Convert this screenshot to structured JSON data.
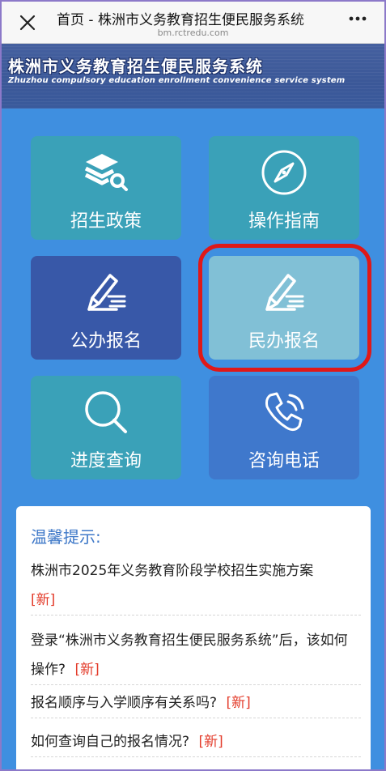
{
  "browser": {
    "title": "首页 - 株洲市义务教育招生便民服务系统",
    "domain": "bm.rctredu.com",
    "close_icon": "close-icon",
    "more_icon": "more-dots-icon"
  },
  "banner": {
    "title_cn": "株洲市义务教育招生便民服务系统",
    "title_en": "Zhuzhou compulsory education enrollment convenience service system"
  },
  "tiles": [
    {
      "label": "招生政策",
      "icon": "books-search-icon",
      "color": "#3aa1b8"
    },
    {
      "label": "操作指南",
      "icon": "compass-icon",
      "color": "#3aa1b8"
    },
    {
      "label": "公办报名",
      "icon": "pen-list-icon",
      "color": "#3858a8"
    },
    {
      "label": "民办报名",
      "icon": "pen-list-icon",
      "color": "#81c0d6"
    },
    {
      "label": "进度查询",
      "icon": "magnifier-icon",
      "color": "#3aa1b8"
    },
    {
      "label": "咨询电话",
      "icon": "phone-icon",
      "color": "#3f78cc"
    }
  ],
  "tips": {
    "title": "温馨提示:",
    "items": [
      {
        "text": "株洲市2025年义务教育阶段学校招生实施方案",
        "badge": "[新]"
      },
      {
        "text": "登录“株洲市义务教育招生便民服务系统”后，该如何操作?",
        "badge": "[新]"
      },
      {
        "text": "报名顺序与入学顺序有关系吗?",
        "badge": "[新]"
      },
      {
        "text": "如何查询自己的报名情况?",
        "badge": "[新]"
      }
    ]
  },
  "colors": {
    "page_bg": "#3f8fe0",
    "highlight": "#e01818",
    "new_badge": "#e33b2a",
    "tips_title": "#3e78c8"
  }
}
